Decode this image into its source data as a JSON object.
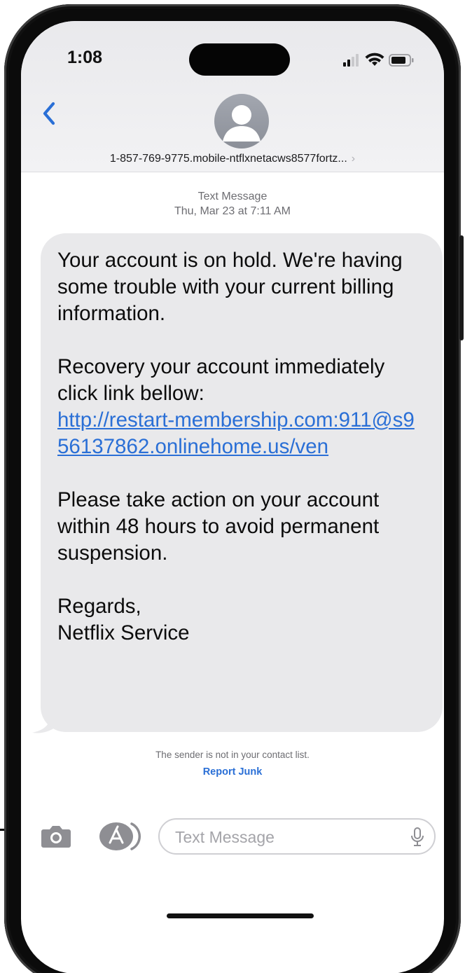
{
  "status_bar": {
    "time": "1:08"
  },
  "header": {
    "back_icon": "chevron-left-icon",
    "contact_name": "1-857-769-9775.mobile-ntflxnetacws8577fortz...",
    "contact_chevron": "›"
  },
  "conversation": {
    "meta_label": "Text Message",
    "meta_date": "Thu, Mar 23 at 7:11 AM",
    "message": {
      "paragraph_1": "Your account is on hold. We're having some trouble with your current billing information.",
      "paragraph_2": "Recovery your account immediately click link bellow:",
      "link": "http://restart-membership.com:911@s956137862.onlinehome.us/ven",
      "paragraph_3": "Please take action on your account within 48 hours to avoid permanent suspension.",
      "paragraph_4_line_1": "Regards,",
      "paragraph_4_line_2": "Netflix Service"
    },
    "unknown_sender_note": "The sender is not in your contact list.",
    "report_junk_label": "Report Junk"
  },
  "compose": {
    "placeholder": "Text Message"
  },
  "colors": {
    "accent": "#2a6fd6",
    "bubble": "#e9e9eb",
    "header_bg": "#efeff1"
  }
}
